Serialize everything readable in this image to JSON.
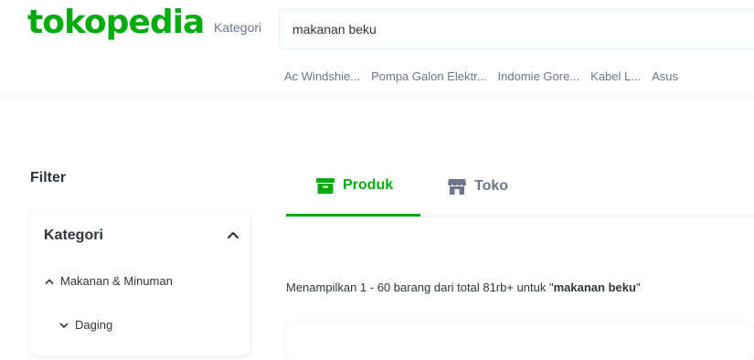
{
  "header": {
    "logo": "tokopedia",
    "kategori_label": "Kategori",
    "search_value": "makanan beku",
    "popular_searches": [
      "Ac Windshie...",
      "Pompa Galon Elektr...",
      "Indomie Gore...",
      "Kabel L...",
      "Asus"
    ]
  },
  "filter": {
    "title": "Filter",
    "kategori": {
      "label": "Kategori",
      "items": [
        {
          "label": "Makanan & Minuman"
        },
        {
          "label": "Daging"
        }
      ]
    }
  },
  "tabs": [
    {
      "label": "Produk",
      "icon": "product-box-icon",
      "active": true
    },
    {
      "label": "Toko",
      "icon": "store-icon",
      "active": false
    }
  ],
  "results": {
    "prefix": "Menampilkan 1 - 60 barang dari total 81rb+ untuk \"",
    "query": "makanan beku",
    "suffix": "\""
  },
  "colors": {
    "brand": "#03ac0e",
    "text": "#31353b",
    "muted": "#6d7588"
  }
}
